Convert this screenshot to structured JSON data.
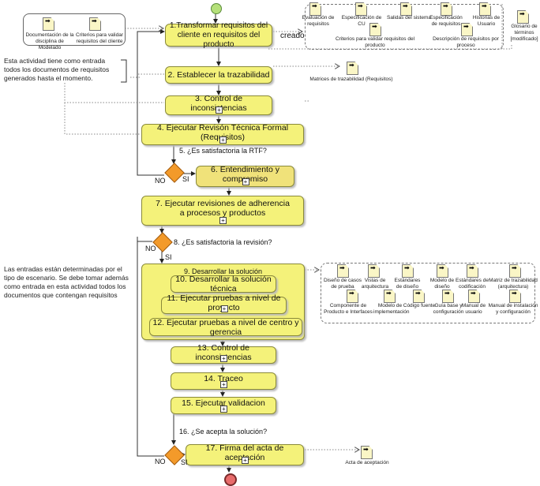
{
  "tasks": {
    "t1": "1.Transformar requisitos del cliente en requisitos del producto",
    "t2": "2. Establecer la trazabilidad",
    "t3": "3. Control de inconsistencias",
    "t4": "4. Ejecutar Revisón Técnica Formal (Requisitos)",
    "t6": "6. Entendimiento y compromiso",
    "t7": "7. Ejecutar revisiones de adherencia a procesos y productos",
    "t9": "9. Desarrollar la solución",
    "t10": "10. Desarrollar la solución técnica",
    "t11": "11. Ejecutar pruebas a nivel de proyecto",
    "t12": "12. Ejecutar pruebas a nivel de centro y gerencia",
    "t13": "13. Control de inconsistencias",
    "t14": "14. Traceo",
    "t15": "15. Ejecutar validacion",
    "t17": "17. Firma del acta de aceptación"
  },
  "gateways": {
    "g5": "5. ¿Es satisfactoria la RTF?",
    "g8": "8. ¿Es satisfactoria la revisión?",
    "g16": "16. ¿Se acepta la solución?"
  },
  "branch": {
    "no": "NO",
    "si": "SI"
  },
  "edge_label": "creado",
  "inputs": [
    "Documentación de la disciplina de Modelado",
    "Criterios para validar requisitos del cliente"
  ],
  "notes": {
    "n1": "Esta actividad tiene como entrada todos los documentos de requisitos generados hasta el momento.",
    "n2": "Las entradas están determinadas por el tipo de escenario. Se debe tomar además como entrada en esta actividad todos los documentos que contengan requisitos"
  },
  "outputs1": [
    "Evaluación de requisitos",
    "Especificación de CU",
    "Salidas del sistema",
    "Especificación de requisitos",
    "Historias de Usuario",
    "Criterios para validar requisitos del producto",
    "Descripción de requisitos por proceso"
  ],
  "glosario": "Glosario de términos [modificado]",
  "matrices": "Matrices de trazabilidad (Requisitos)",
  "outputs9": [
    "Diseño de casos de prueba",
    "Vistas de arquitectura",
    "Estándares de diseño",
    "Modelo de diseño",
    "Estándares de codificación",
    "Matriz de trazabilidad (arquitectura)",
    "Componente de Producto e Interfaces",
    "Modelo de implementación",
    "Código fuente",
    "Guía base y configuración",
    "Manual de usuario",
    "Manual de instalación y configuración"
  ],
  "acta": "Acta de aceptación",
  "colors": {
    "task": "#f4f27a",
    "start": "#b5e07a",
    "end": "#e86b6b",
    "gateway": "#f39a2a"
  }
}
